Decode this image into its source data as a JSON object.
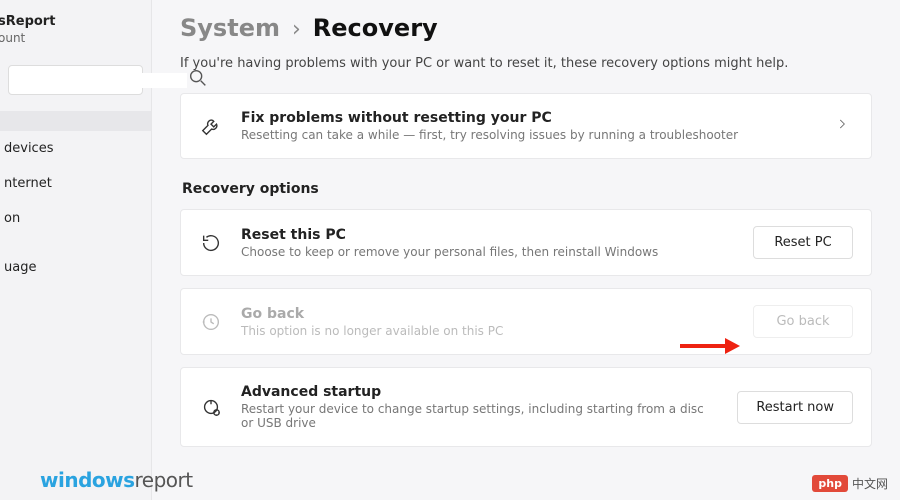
{
  "profile": {
    "name": "sReport",
    "sub": "ount"
  },
  "search": {
    "placeholder": ""
  },
  "nav": {
    "items": [
      {
        "label": ""
      },
      {
        "label": "devices"
      },
      {
        "label": "nternet"
      },
      {
        "label": "on"
      },
      {
        "label": "uage"
      }
    ]
  },
  "breadcrumb": {
    "parent": "System",
    "sep": "›",
    "current": "Recovery"
  },
  "intro": "If you're having problems with your PC or want to reset it, these recovery options might help.",
  "fixcard": {
    "title": "Fix problems without resetting your PC",
    "sub": "Resetting can take a while — first, try resolving issues by running a troubleshooter"
  },
  "section_header": "Recovery options",
  "reset": {
    "title": "Reset this PC",
    "sub": "Choose to keep or remove your personal files, then reinstall Windows",
    "button": "Reset PC"
  },
  "goback": {
    "title": "Go back",
    "sub": "This option is no longer available on this PC",
    "button": "Go back"
  },
  "advanced": {
    "title": "Advanced startup",
    "sub": "Restart your device to change startup settings, including starting from a disc or USB drive",
    "button": "Restart now"
  },
  "watermark": {
    "left1": "windows",
    "left2": "report",
    "right_badge": "php",
    "right_text": "中文网"
  }
}
